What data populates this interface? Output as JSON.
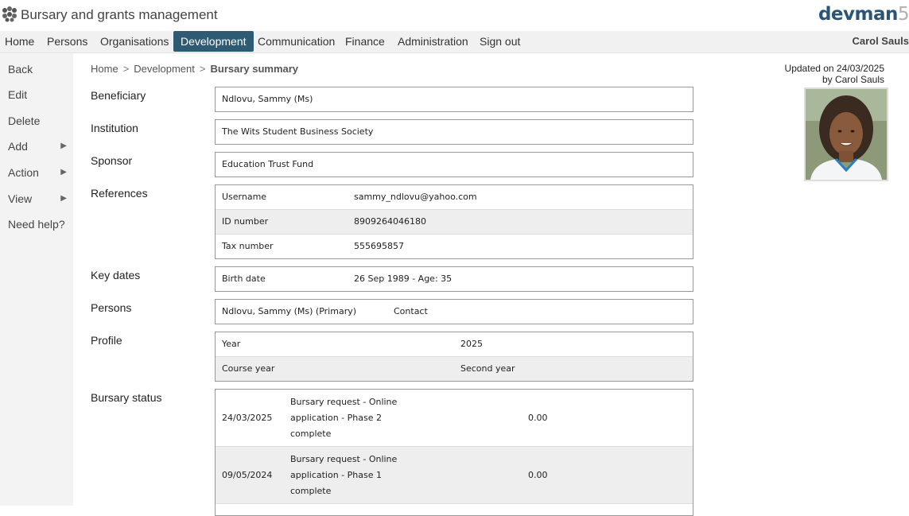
{
  "app": {
    "title": "Bursary and grants management",
    "brand": "devman",
    "brand_version": "5"
  },
  "nav": {
    "items": [
      "Home",
      "Persons",
      "Organisations",
      "Development",
      "Communication",
      "Finance",
      "Administration",
      "Sign out"
    ],
    "active": "Development",
    "user": "Carol Sauls"
  },
  "sidebar": {
    "items": [
      "Back",
      "Edit",
      "Delete",
      "Add",
      "Action",
      "View",
      "Need help?"
    ],
    "arrow": "▶"
  },
  "breadcrumb": {
    "items": [
      "Home",
      "Development"
    ],
    "current": "Bursary summary",
    "separator": ">"
  },
  "updated": {
    "line1": "Updated on 24/03/2025",
    "line2": "by Carol Sauls"
  },
  "labels": {
    "beneficiary": "Beneficiary",
    "institution": "Institution",
    "sponsor": "Sponsor",
    "references": "References",
    "key_dates": "Key dates",
    "persons": "Persons",
    "profile": "Profile",
    "bursary_status": "Bursary status"
  },
  "beneficiary": "Ndlovu, Sammy (Ms)",
  "institution": "The Wits Student Business Society",
  "sponsor": "Education Trust Fund",
  "references": [
    {
      "label": "Username",
      "value": "sammy_ndlovu@yahoo.com"
    },
    {
      "label": "ID number",
      "value": "8909264046180"
    },
    {
      "label": "Tax number",
      "value": "555695857"
    }
  ],
  "key_dates": [
    {
      "label": "Birth date",
      "value": "26 Sep 1989 - Age: 35"
    }
  ],
  "persons": [
    {
      "name": "Ndlovu, Sammy (Ms) (Primary)",
      "role": "Contact"
    }
  ],
  "profile": [
    {
      "label": "Year",
      "value": "2025"
    },
    {
      "label": "Course year",
      "value": "Second year"
    }
  ],
  "bursary_status": [
    {
      "date": "24/03/2025",
      "description": "Bursary request - Online application - Phase 2 complete",
      "amount": "0.00"
    },
    {
      "date": "09/05/2024",
      "description": "Bursary request - Online application - Phase 1 complete",
      "amount": "0.00"
    }
  ],
  "colors": {
    "active_nav": "#2e5b73",
    "brand": "#2b5577"
  }
}
